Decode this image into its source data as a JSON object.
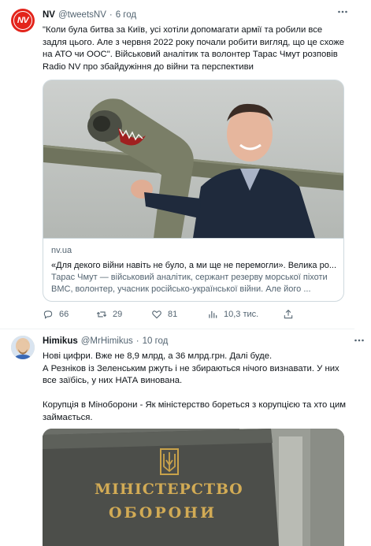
{
  "tweet1": {
    "avatar_text": "NV",
    "name": "NV",
    "handle": "@tweetsNV",
    "separator": "·",
    "time": "6 год",
    "text": "\"Коли була битва за Київ, усі хотіли допомагати армії та робили все задля цього. Але з червня 2022 року почали робити вигляд, що це схоже на АТО чи ООС\". Військовий аналітик та волонтер Тарас Чмут розповів Radio NV про збайдужіння до війни та перспективи",
    "card": {
      "domain": "nv.ua",
      "title": "«Для декого війни навіть не було, а ми ще не перемогли». Велика ро...",
      "description": "Тарас Чмут — військовий аналітик, сержант резерву морської піхоти ВМС, волонтер, учасник російсько-української війни. Але його ..."
    },
    "actions": {
      "replies": "66",
      "retweets": "29",
      "likes": "81",
      "views": "10,3 тис."
    }
  },
  "tweet2": {
    "name": "Himikus",
    "handle": "@MrHimikus",
    "separator": "·",
    "time": "10 год",
    "text": "Нові цифри. Вже не 8,9 млрд, а 36 млрд.грн. Далі буде.\nА Резніков із Зеленським ржуть і не збираються нічого визнавати. У них все заїбісь, у них НАТА винована.\n\nКорупція в Міноборони - Як міністерство бореться з корупцією та хто цим займається.",
    "image_sign_line1": "МІНІСТЕРСТВО",
    "image_sign_line2": "ОБОРОНИ"
  },
  "icons": [
    "more-icon",
    "reply-icon",
    "retweet-icon",
    "like-icon",
    "views-icon",
    "share-icon"
  ],
  "colors": {
    "nv_red": "#e3241b",
    "secondary_text": "#536471",
    "border": "#cfd9de"
  }
}
